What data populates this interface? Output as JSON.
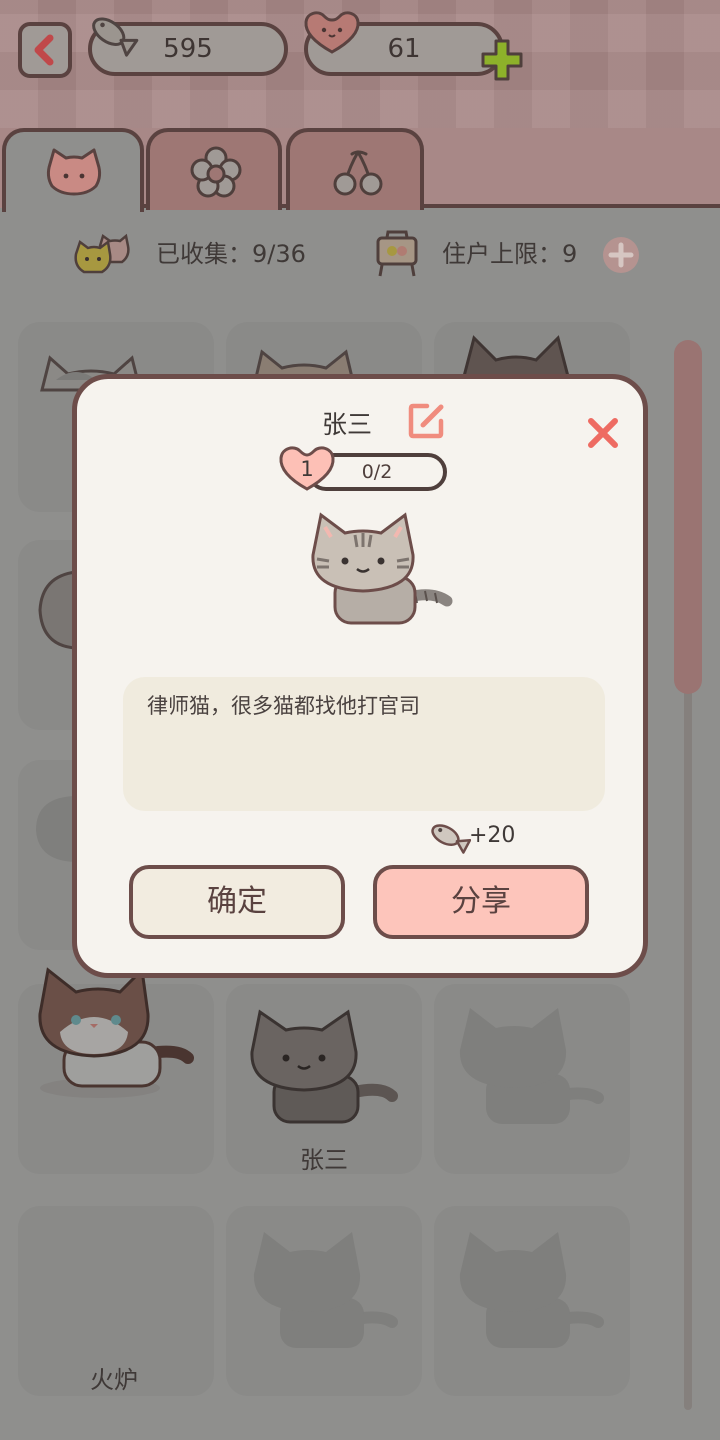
{
  "currency": {
    "fish_count": "595",
    "heart_count": "61",
    "fish_icon": "fish-icon",
    "heart_icon": "heart-icon",
    "add_icon": "plus-icon"
  },
  "tabs": [
    {
      "icon": "cat-face-icon",
      "selected": true
    },
    {
      "icon": "flower-icon",
      "selected": false
    },
    {
      "icon": "cherry-icon",
      "selected": false
    }
  ],
  "collection": {
    "collected_text": "已收集：9/36",
    "capacity_text": "住户上限：9"
  },
  "grid_labels": {
    "zhangsan": "张三",
    "stove": "火炉"
  },
  "modal": {
    "cat_name": "张三",
    "level": "1",
    "progress": "0/2",
    "description": "律师猫，很多猫都找他打官司",
    "reward": "+20",
    "confirm_label": "确定",
    "share_label": "分享"
  },
  "colors": {
    "accent_pink": "#fdc5bb",
    "close_red": "#ee6b62",
    "border_brown": "#6d4d4a",
    "plus_green": "#8db12a"
  }
}
